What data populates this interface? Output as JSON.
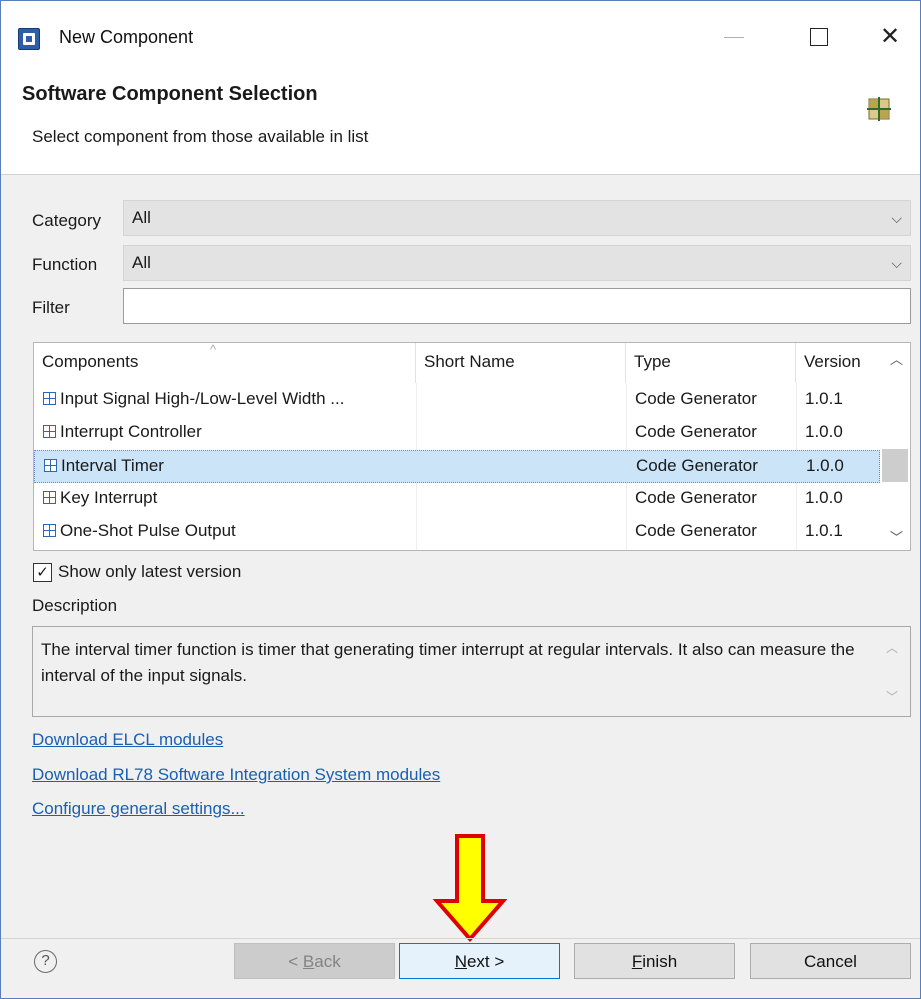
{
  "window": {
    "title": "New Component"
  },
  "header": {
    "title": "Software Component Selection",
    "subtitle": "Select component from those available in list"
  },
  "form": {
    "category_label": "Category",
    "category_value": "All",
    "function_label": "Function",
    "function_value": "All",
    "filter_label": "Filter",
    "filter_value": ""
  },
  "table": {
    "columns": [
      "Components",
      "Short Name",
      "Type",
      "Version"
    ],
    "rows": [
      {
        "component": "Input Signal High-/Low-Level Width ...",
        "short_name": "",
        "type": "Code Generator",
        "version": "1.0.1"
      },
      {
        "component": "Interrupt Controller",
        "short_name": "",
        "type": "Code Generator",
        "version": "1.0.0"
      },
      {
        "component": "Interval Timer",
        "short_name": "",
        "type": "Code Generator",
        "version": "1.0.0",
        "selected": true
      },
      {
        "component": "Key Interrupt",
        "short_name": "",
        "type": "Code Generator",
        "version": "1.0.0"
      },
      {
        "component": "One-Shot Pulse Output",
        "short_name": "",
        "type": "Code Generator",
        "version": "1.0.1"
      }
    ]
  },
  "options": {
    "latest_only_label": "Show only latest version",
    "latest_only_checked": true
  },
  "description": {
    "label": "Description",
    "text": "The interval timer function is timer that generating timer interrupt at regular intervals. It also can measure the interval of the input signals."
  },
  "links": [
    "Download ELCL modules",
    "Download RL78 Software Integration System modules",
    "Configure general settings..."
  ],
  "buttons": {
    "back_prefix": "< ",
    "back_mnemonic": "B",
    "back_rest": "ack",
    "next_mnemonic": "N",
    "next_rest": "ext >",
    "finish_mnemonic": "F",
    "finish_rest": "inish",
    "cancel": "Cancel"
  },
  "colors": {
    "selection": "#cce4f7",
    "link": "#1a5fb4",
    "annotation_arrow": "#ffff00",
    "annotation_outline": "#e00000"
  },
  "icons": {
    "help": "help-circle-icon",
    "component": "grid-icon",
    "wizard": "component-grid-icon"
  }
}
